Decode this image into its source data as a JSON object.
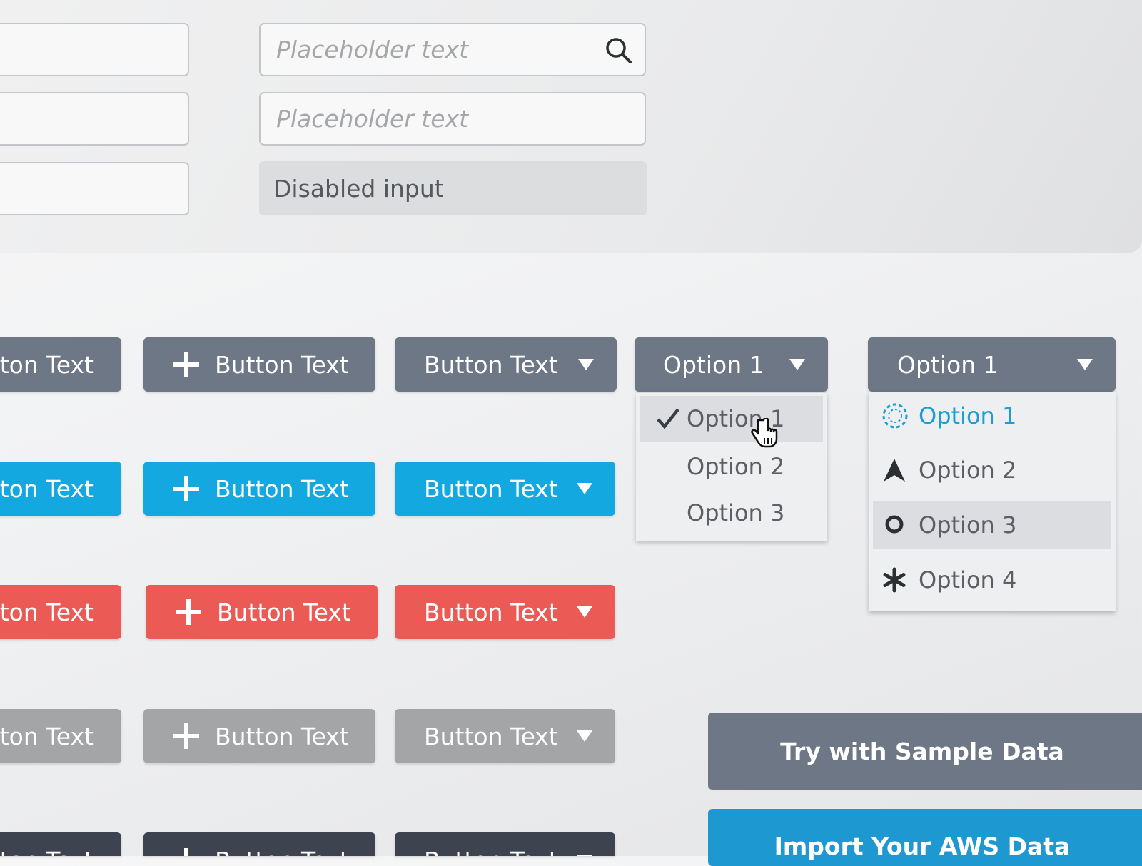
{
  "colors": {
    "gray": "#6d7785",
    "blue": "#14a8e0",
    "red": "#ec5a55",
    "light_gray": "#a4a5a7",
    "dark": "#3d4450",
    "accent_text": "#1d9dd6"
  },
  "inputs": {
    "search_placeholder": "Placeholder text",
    "text_placeholder": "Placeholder text",
    "disabled_value": "Disabled input",
    "search_icon": "search-icon"
  },
  "buttons": {
    "rows": [
      {
        "style": "gray",
        "text": "Button Text",
        "plus_text": "Button Text",
        "dropdown_text": "Button Text"
      },
      {
        "style": "blue",
        "text": "Button Text",
        "plus_text": "Button Text",
        "dropdown_text": "Button Text"
      },
      {
        "style": "red",
        "text": "Button Text",
        "plus_text": "Button Text",
        "dropdown_text": "Button Text"
      },
      {
        "style": "light-gray",
        "text": "Button Text",
        "plus_text": "Button Text",
        "dropdown_text": "Button Text"
      },
      {
        "style": "dark",
        "text": "Button Text",
        "plus_text": "Button Text",
        "dropdown_text": "Button Text"
      }
    ]
  },
  "dropdown_a": {
    "selected": "Option 1",
    "options": [
      "Option 1",
      "Option 2",
      "Option 3"
    ],
    "checked_option": "Option 1",
    "hovered_option": "Option 1"
  },
  "dropdown_b": {
    "selected": "Option 1",
    "options": [
      {
        "label": "Option 1",
        "icon": "dashed-circle-icon",
        "active": true
      },
      {
        "label": "Option 2",
        "icon": "navigation-arrow-icon",
        "active": false
      },
      {
        "label": "Option 3",
        "icon": "ring-icon",
        "active": false
      },
      {
        "label": "Option 4",
        "icon": "asterisk-icon",
        "active": false
      }
    ],
    "hovered_option": "Option 3"
  },
  "cta": {
    "sample_data": "Try with Sample Data",
    "import_aws": "Import Your AWS Data"
  }
}
